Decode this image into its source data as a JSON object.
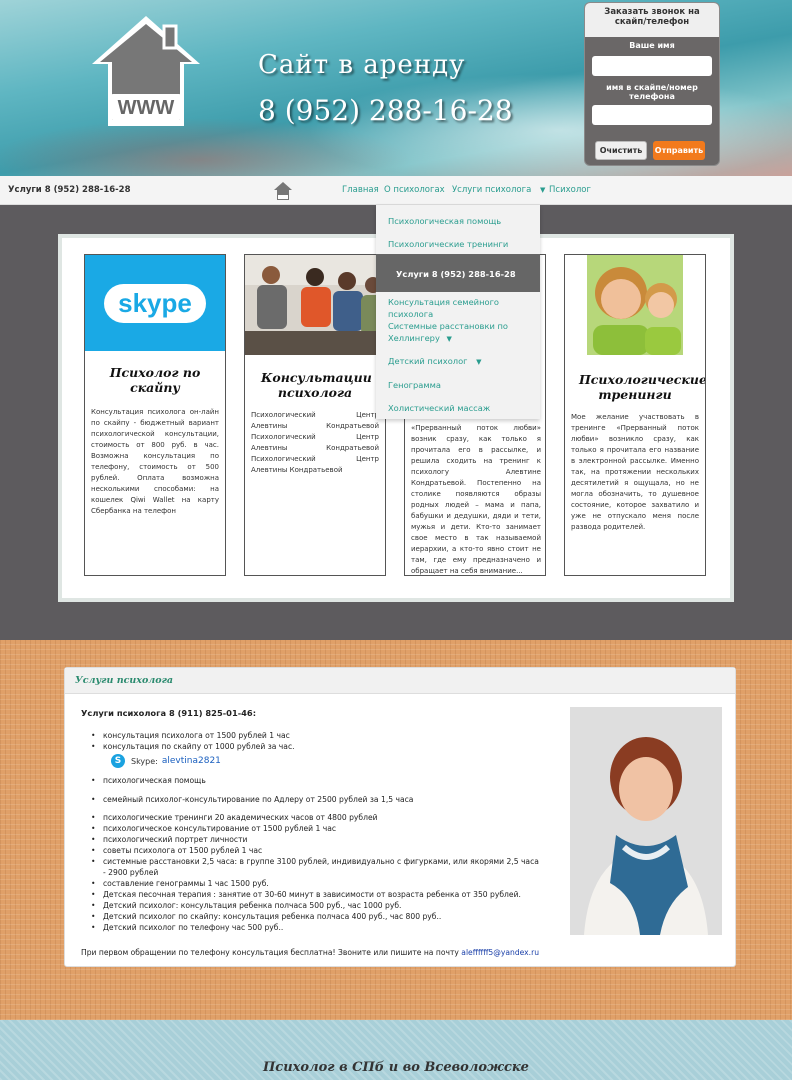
{
  "header": {
    "slogan": "Сайт в аренду",
    "phone": "8 (952) 288-16-28",
    "logo_text": "WWW"
  },
  "callback_form": {
    "title": "Заказать звонок на скайп/телефон",
    "name_label": "Ваше имя",
    "contact_label": "имя в скайпе/номер телефона",
    "name_value": "",
    "contact_value": "",
    "clear_button": "Очистить",
    "send_button": "Отправить",
    "send_color": "#f27a1c"
  },
  "nav": {
    "phone": "Услуги 8 (952) 288-16-28",
    "items": [
      "Главная",
      "О психологах",
      "Услуги психолога",
      "Психолог"
    ],
    "arrow": "▼",
    "dropdown": {
      "items": [
        "Психологическая помощь",
        "Психологические тренинги",
        "Услуги 8 (952) 288-16-28",
        "Консультация семейного психолога",
        "Системные расстановки по Хеллингеру",
        "Детский психолог",
        "Генограмма",
        "Холистический массаж"
      ]
    }
  },
  "cards": [
    {
      "title": "Психолог по скайпу",
      "image": "skype",
      "image_text": "skype",
      "text": "Консультация психолога он-лайн по скайпу - бюджетный вариант психологической консультации, стоимость от 800 руб. в час. Возможна консультация по телефону, стоимость от 500 рублей. Оплата возможна несколькими способами: на кошелек Qiwi Wallet на карту Сбербанка на телефон"
    },
    {
      "title": "Консультации психолога",
      "image": "group-session",
      "text": "Психологический Центр Алевтины Кондратьевой Психологический Центр Алевтины Кондратьевой Психологический Центр Алевтины Кондратьевой"
    },
    {
      "title": "",
      "image": "",
      "text": "«Прерванный поток любви» возник сразу, как только я прочитала его в рассылке, и решила сходить на тренинг к психологу Алевтине Кондратьевой. Постепенно на столике появляются образы родных людей – мама и папа, бабушки и дедушки, дяди и тети, мужья и дети. Кто-то занимает свое место в так называемой иерархии, а кто-то явно стоит не там, где ему предназначено и обращает на себя внимание..."
    },
    {
      "title": "Психологические тренинги",
      "image": "young-people",
      "text": "Мое желание участвовать в тренинге «Прерванный поток любви» возникло сразу, как только я прочитала его название в электронной рассылке. Именно так, на протяжении нескольких десятилетий я ощущала, но не могла обозначить, то душевное состояние, которое захватило и уже не отпускало меня после развода родителей."
    }
  ],
  "services": {
    "heading": "Услуги психолога",
    "intro": "Услуги психолога 8 (911) 825-01-46:",
    "items_top": [
      "консультация психолога от 1500 рублей 1 час",
      "консультация по скайпу от 1000 рублей за час."
    ],
    "skype_label": "Skype:",
    "skype_id": "alevtina2821",
    "item_help": "психологическая помощь",
    "item_family": "семейный психолог-консультирование по Адлеру от 2500 рублей за 1,5 часа",
    "items_bottom": [
      "психологические тренинги 20 академических часов от 4800 рублей",
      "психологическое консультирование от 1500 рублей 1 час",
      "психологический портрет личности",
      "советы психолога от 1500 рублей 1 час",
      "системные расстановки 2,5 часа: в группе 3100 рублей, индивидуально с фигурками, или якорями 2,5 часа - 2900 рублей",
      "составление генограммы 1 час 1500 руб.",
      "Детская песочная терапия : занятие от 30-60 минут в зависимости от возраста ребенка от 350 рублей.",
      "Детский психолог: консультация ребенка полчаса 500 руб., час 1000 руб.",
      "Детский психолог по скайпу: консультация ребенка полчаса 400 руб., час 800 руб..",
      "Детский психолог по телефону час 500 руб.."
    ],
    "footer_text": "При первом обращении по телефону консультация бесплатна! Звоните или пишите на почту",
    "email": "aleffffff5@yandex.ru"
  },
  "footer": {
    "title": "Психолог в СПб и во Всеволожске"
  }
}
